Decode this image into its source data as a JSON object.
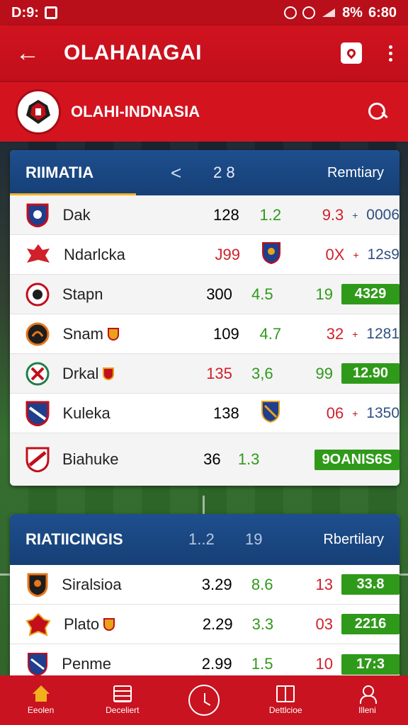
{
  "status_bar": {
    "time_left": "D:9:",
    "battery": "8%",
    "clock": "6:80"
  },
  "app_bar": {
    "title": "OLAHAIAGAI",
    "back_icon": "back-arrow-icon",
    "share_icon": "share-icon",
    "more_icon": "more-vert-icon"
  },
  "brand": {
    "name": "OLAHI-INDNASIA",
    "logo_icon": "eagle-crest-icon",
    "search_icon": "search-icon"
  },
  "colors": {
    "brand_red": "#d3141f",
    "header_blue": "#1e4f8e",
    "positive_green": "#2f9a1a",
    "negative_red": "#d0202a"
  },
  "table1": {
    "title": "RIIMATIA",
    "nav": "<",
    "round": "2 8",
    "right": "Remtiary",
    "rows": [
      {
        "team": "Dak",
        "c1": "128",
        "c2": "1.2",
        "c3": "9.3",
        "arrow": "+",
        "last": "0006",
        "last_type": "text"
      },
      {
        "team": "Ndarlcka",
        "c1": "J99",
        "c1_color": "red",
        "c2": "",
        "c3": "0X",
        "arrow": "+",
        "last": "12s9",
        "last_type": "text"
      },
      {
        "team": "Stapn",
        "c1": "300",
        "c2": "4.5",
        "c3": "19",
        "c3_color": "green",
        "last": "4329",
        "last_type": "pill"
      },
      {
        "team": "Snam",
        "c1": "109",
        "c2": "4.7",
        "c3": "32",
        "arrow": "+",
        "last": "1281",
        "last_type": "text"
      },
      {
        "team": "Drkal",
        "c1": "135",
        "c1_color": "red",
        "c2": "3,6",
        "c3": "99",
        "c3_color": "green",
        "last": "12.90",
        "last_type": "pill"
      },
      {
        "team": "Kuleka",
        "c1": "138",
        "c2": "",
        "c3": "06",
        "arrow": "+",
        "last": "1350",
        "last_type": "text"
      },
      {
        "team": "Biahuke",
        "c1": "36",
        "c2": "1.3",
        "c3": "",
        "last": "9OANIS6S",
        "last_type": "pill-wide"
      }
    ]
  },
  "table2": {
    "title": "RIATIICINGIS",
    "round_a": "1..2",
    "round_b": "19",
    "right": "Rbertilary",
    "rows": [
      {
        "team": "Siralsioa",
        "c1": "3.29",
        "c2": "8.6",
        "c3": "13",
        "last": "33.8"
      },
      {
        "team": "Plato",
        "c1": "2.29",
        "c2": "3.3",
        "c3": "03",
        "last": "2216"
      },
      {
        "team": "Penme",
        "c1": "2.99",
        "c2": "1.5",
        "c3": "10",
        "last": "17:3"
      }
    ]
  },
  "bottom_nav": [
    {
      "label": "Eeolen",
      "icon": "home-icon"
    },
    {
      "label": "Deceliert",
      "icon": "document-icon"
    },
    {
      "label": "",
      "icon": "clock-icon"
    },
    {
      "label": "Dettlcioe",
      "icon": "book-icon"
    },
    {
      "label": "Illeni",
      "icon": "user-icon"
    }
  ]
}
